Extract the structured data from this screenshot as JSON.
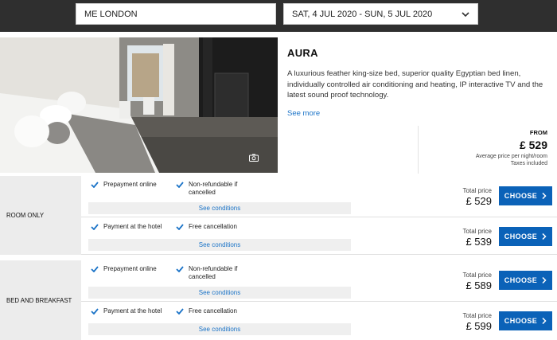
{
  "search": {
    "hotel": "ME LONDON",
    "dates": "SAT, 4 JUL 2020 - SUN, 5 JUL 2020"
  },
  "room": {
    "title": "AURA",
    "description": "A luxurious feather king-size bed, superior quality Egyptian bed linen, individually controlled air conditioning and heating, IP interactive TV and the latest sound proof technology.",
    "see_more": "See more",
    "from_label": "FROM",
    "from_price": "£ 529",
    "avg_label": "Average price per night/room",
    "taxes_label": "Taxes included"
  },
  "boards": [
    {
      "name": "ROOM ONLY",
      "rates": [
        {
          "feature1": "Prepayment online",
          "feature2": "Non-refundable if cancelled",
          "conditions": "See conditions",
          "total_label": "Total price",
          "price": "£ 529",
          "button": "CHOOSE"
        },
        {
          "feature1": "Payment at the hotel",
          "feature2": "Free cancellation",
          "conditions": "See conditions",
          "total_label": "Total price",
          "price": "£ 539",
          "button": "CHOOSE"
        }
      ]
    },
    {
      "name": "BED AND BREAKFAST",
      "rates": [
        {
          "feature1": "Prepayment online",
          "feature2": "Non-refundable if cancelled",
          "conditions": "See conditions",
          "total_label": "Total price",
          "price": "£ 589",
          "button": "CHOOSE"
        },
        {
          "feature1": "Payment at the hotel",
          "feature2": "Free cancellation",
          "conditions": "See conditions",
          "total_label": "Total price",
          "price": "£ 599",
          "button": "CHOOSE"
        }
      ]
    }
  ],
  "icons": {
    "dropdown": "chevron-down-icon",
    "camera": "camera-icon",
    "check": "check-icon",
    "choose": "chevron-right-icon"
  },
  "colors": {
    "accent": "#0b62b8",
    "link": "#1a73c7",
    "topbar": "#2f2f2f"
  }
}
